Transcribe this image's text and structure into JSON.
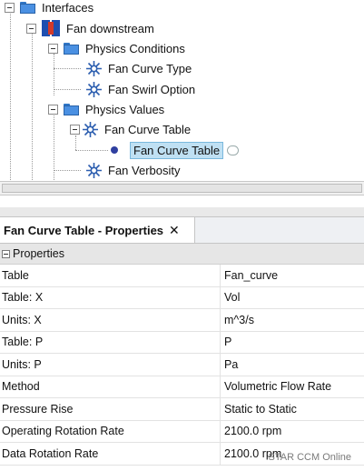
{
  "tree": {
    "items": [
      {
        "label": "Interfaces",
        "icon": "folder-icon"
      },
      {
        "label": "Fan downstream",
        "icon": "boundary-icon"
      },
      {
        "label": "Physics Conditions",
        "icon": "folder-icon"
      },
      {
        "label": "Fan Curve Type",
        "icon": "fan-property-icon"
      },
      {
        "label": "Fan Swirl Option",
        "icon": "fan-property-icon"
      },
      {
        "label": "Physics Values",
        "icon": "folder-icon"
      },
      {
        "label": "Fan Curve Table",
        "icon": "fan-property-icon"
      },
      {
        "label": "Fan Curve Table",
        "icon": "dot-icon",
        "selected": true
      },
      {
        "label": "Fan Verbosity",
        "icon": "fan-property-icon"
      }
    ]
  },
  "properties_panel": {
    "tab_title": "Fan Curve Table - Properties",
    "close_glyph": "✕",
    "section_label": "Properties",
    "rows": [
      {
        "name": "Table",
        "value": "Fan_curve"
      },
      {
        "name": "Table: X",
        "value": "Vol"
      },
      {
        "name": "Units: X",
        "value": "m^3/s"
      },
      {
        "name": "Table: P",
        "value": "P"
      },
      {
        "name": "Units: P",
        "value": "Pa"
      },
      {
        "name": "Method",
        "value": "Volumetric Flow Rate"
      },
      {
        "name": "Pressure Rise",
        "value": "Static to Static"
      },
      {
        "name": "Operating Rotation Rate",
        "value": "2100.0 rpm"
      },
      {
        "name": "Data Rotation Rate",
        "value": "2100.0 rpm"
      }
    ]
  },
  "watermark": "STAR CCM Online",
  "colors": {
    "folder": "#4a90e2",
    "selection": "#bfe0f3",
    "fan_icon": "#2d5fb0"
  }
}
